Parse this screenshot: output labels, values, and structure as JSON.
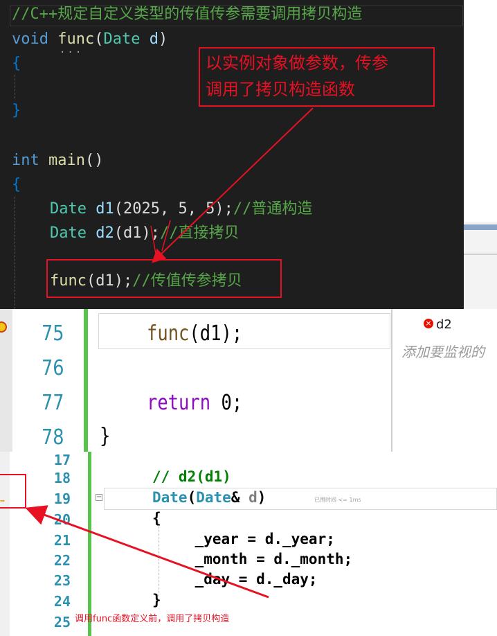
{
  "panel1": {
    "comment_header": "//C++规定自定义类型的传值传参需要调用拷贝构造",
    "func_decl": {
      "kw": "void",
      "name": "func",
      "open": "(",
      "type": "Date",
      "param": " d",
      "close": ")"
    },
    "brace_open": "{",
    "brace_close": "}",
    "main_decl": {
      "kw": "int",
      "name": "main",
      "parens": "()"
    },
    "main_open": "{",
    "line_d1": {
      "type": "Date",
      "var": " d1",
      "args": "(2025, 5, 5);",
      "comment": "//普通构造"
    },
    "line_d2": {
      "type": "Date",
      "var": " d2",
      "args": "(d1);",
      "comment": "//直接拷贝"
    },
    "line_call": {
      "name": "func",
      "args": "(d1);",
      "comment": "//传值传参拷贝"
    },
    "callout": {
      "line1": "以实例对象做参数，传参",
      "line2": "调用了拷贝构造函数"
    },
    "squiggle": "..."
  },
  "panel2": {
    "lines": [
      {
        "num": "75",
        "code_fn": "func",
        "code_rest": "(d1);"
      },
      {
        "num": "76"
      },
      {
        "num": "77",
        "code_kw": "return",
        "code_rest": " 0;"
      },
      {
        "num": "78",
        "code_rest": "}"
      }
    ],
    "watch": {
      "name": "d2",
      "hint": "添加要监视的"
    }
  },
  "panel3": {
    "lines": [
      {
        "num": "17"
      },
      {
        "num": "18",
        "comment": "// d2(d1)"
      },
      {
        "num": "19",
        "kw": "Date",
        "open": "(",
        "kw2": "Date",
        "amp": "& ",
        "param": "d",
        "close": ")"
      },
      {
        "num": "20",
        "text": "{"
      },
      {
        "num": "21",
        "text": "    _year = d._year;"
      },
      {
        "num": "22",
        "text": "    _month = d._month;"
      },
      {
        "num": "23",
        "text": "    _day = d._day;"
      },
      {
        "num": "24",
        "text": "}"
      },
      {
        "num": "25"
      }
    ],
    "perf_tip": "已用时间 <= 1ms",
    "note": "调用func函数定义前，调用了拷贝构造"
  },
  "colors": {
    "accent_red": "#e81123",
    "editor_bg": "#1e1e1e",
    "gutter_green": "#57c34a"
  }
}
